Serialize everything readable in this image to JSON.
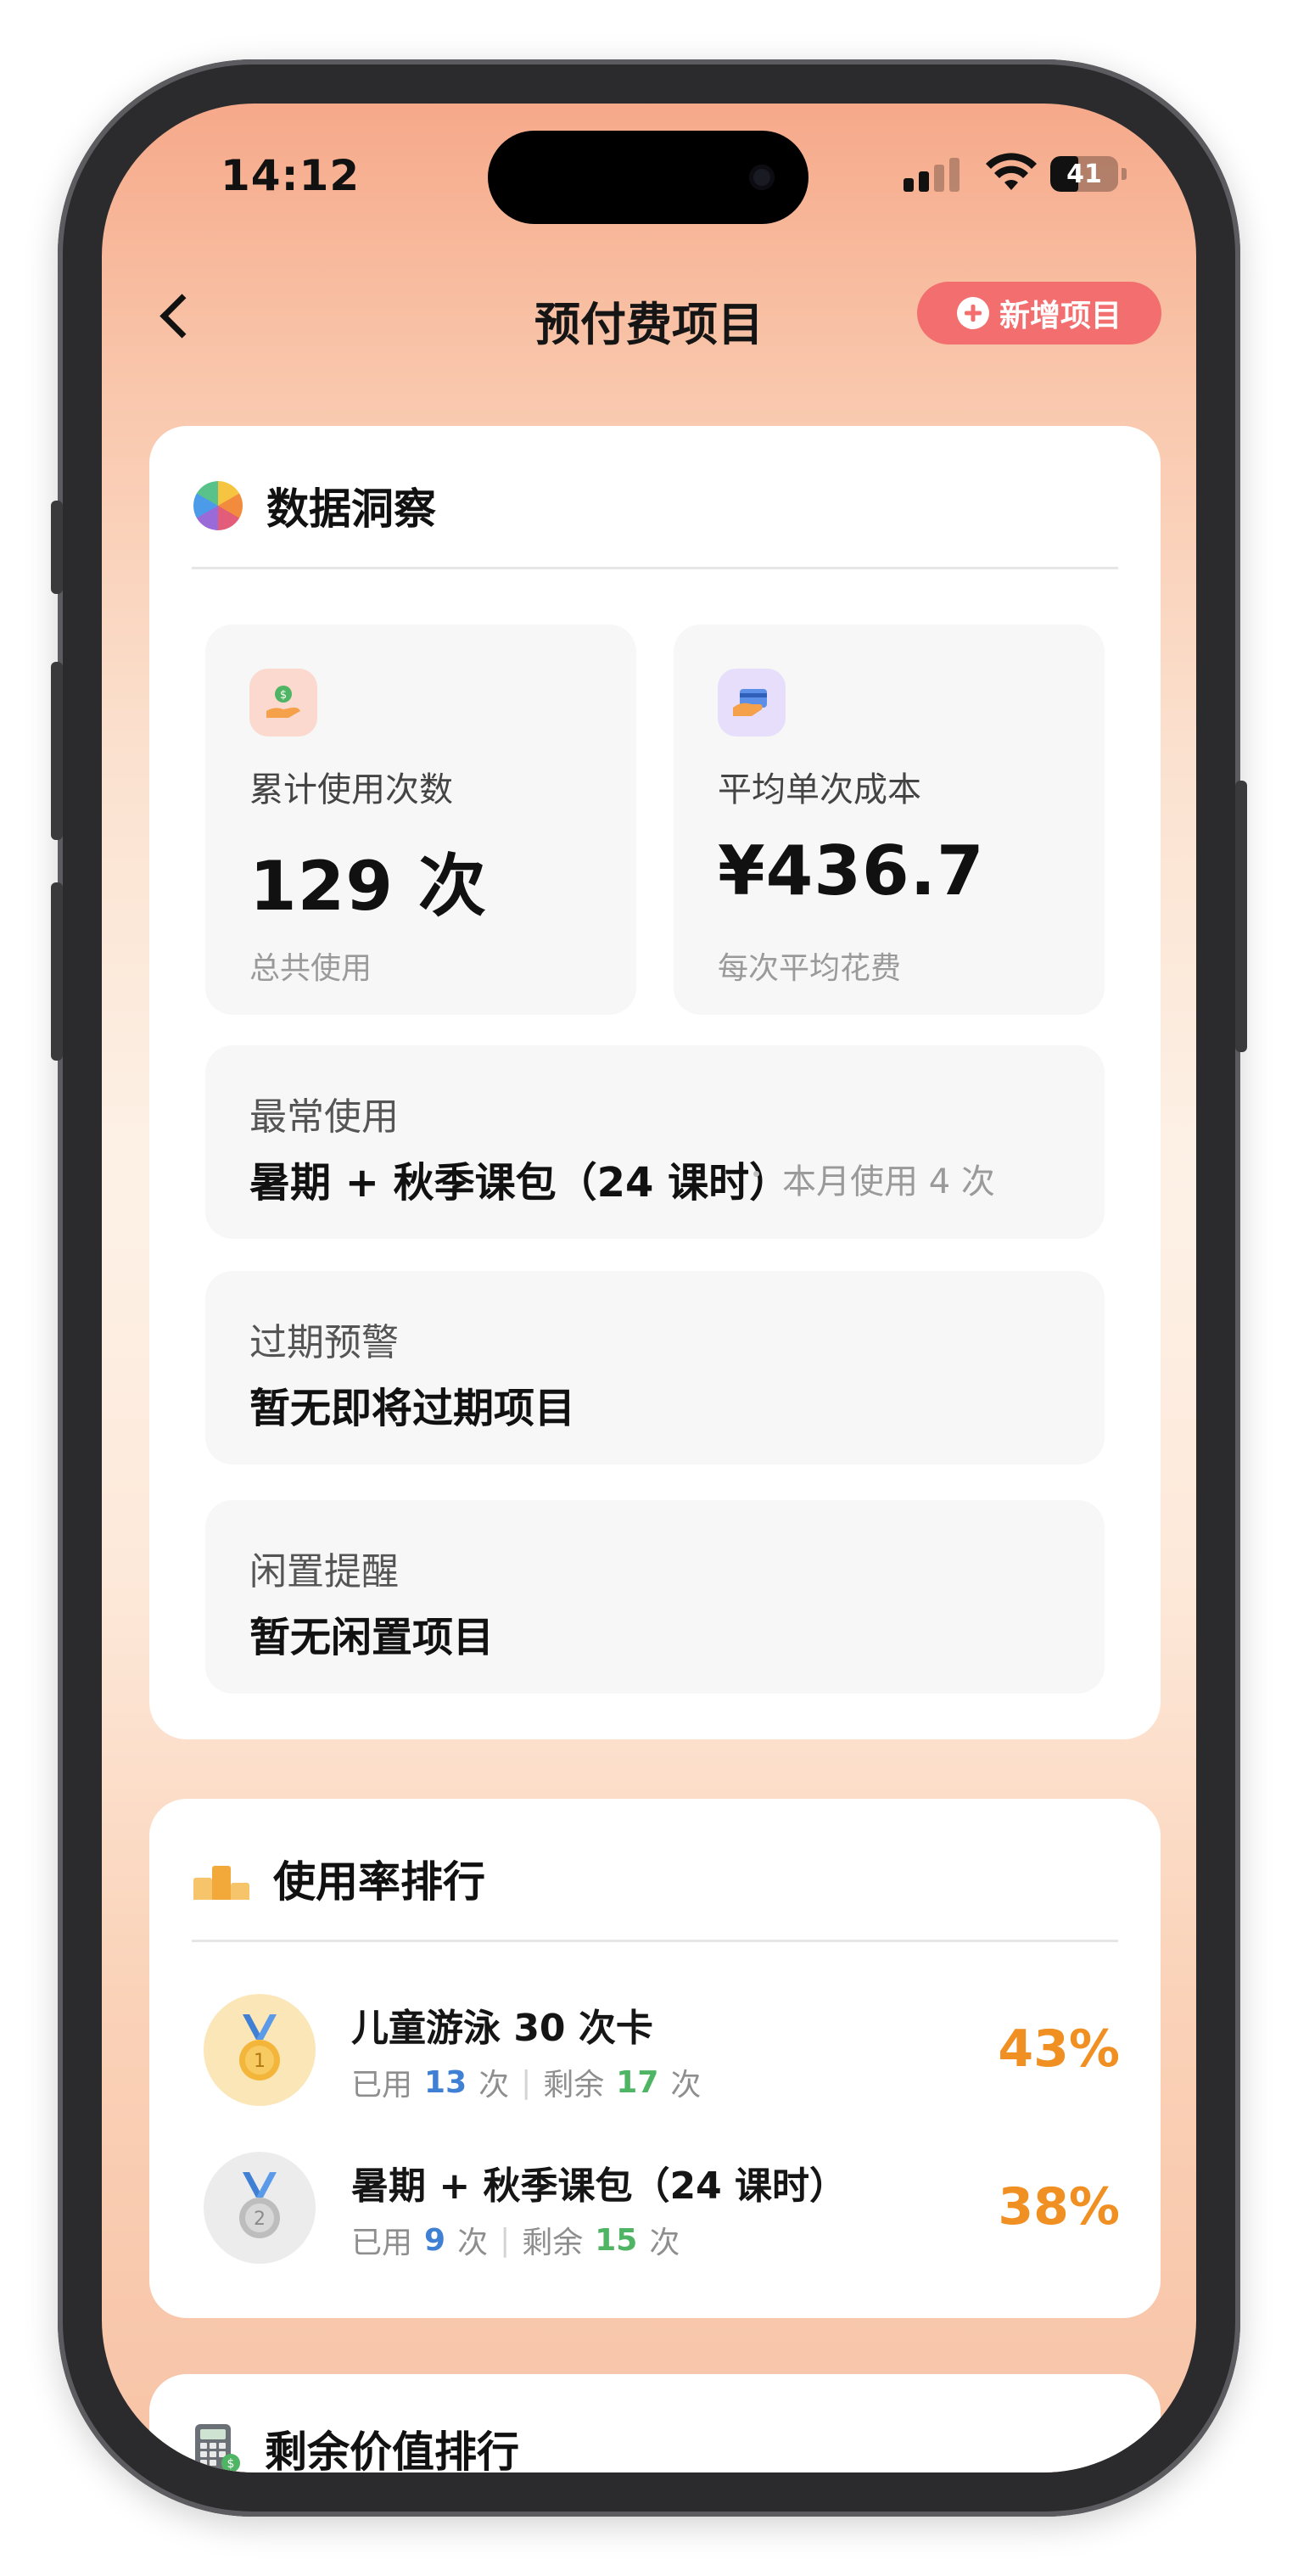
{
  "status_bar": {
    "time": "14:12",
    "battery_level": "41",
    "battery_fraction": 0.41
  },
  "nav": {
    "back_icon": "chevron-left-icon",
    "title": "预付费项目",
    "add_button_label": "新增项目",
    "add_icon": "plus-circle-icon"
  },
  "insights": {
    "title": "数据洞察",
    "icon": "pie-chart-icon",
    "total_uses": {
      "icon": "money-hand-icon",
      "label": "累计使用次数",
      "value": "129 次",
      "sub": "总共使用"
    },
    "avg_cost": {
      "icon": "credit-card-icon",
      "label": "平均单次成本",
      "value": "¥436.7",
      "sub": "每次平均花费"
    },
    "most_used": {
      "label": "最常使用",
      "value": "暑期 + 秋季课包（24 课时）",
      "extra": "本月使用 4 次"
    },
    "expiry_warning": {
      "label": "过期预警",
      "value": "暂无即将过期项目"
    },
    "idle_reminder": {
      "label": "闲置提醒",
      "value": "暂无闲置项目"
    }
  },
  "usage_ranking": {
    "title": "使用率排行",
    "icon": "podium-icon",
    "used_prefix": "已用",
    "left_prefix": "剩余",
    "unit": "次",
    "items": [
      {
        "rank_icon": "gold-medal-icon",
        "name": "儿童游泳 30 次卡",
        "used": "13",
        "left": "17",
        "percent": "43%"
      },
      {
        "rank_icon": "silver-medal-icon",
        "name": "暑期 + 秋季课包（24 课时）",
        "used": "9",
        "left": "15",
        "percent": "38%"
      }
    ],
    "colors": {
      "used": "#3f7fd4",
      "left": "#4fb463",
      "percent": "#f08f22"
    }
  },
  "value_ranking": {
    "title": "剩余价值排行",
    "icon": "calculator-icon"
  },
  "colors": {
    "accent": "#f36f6f"
  }
}
